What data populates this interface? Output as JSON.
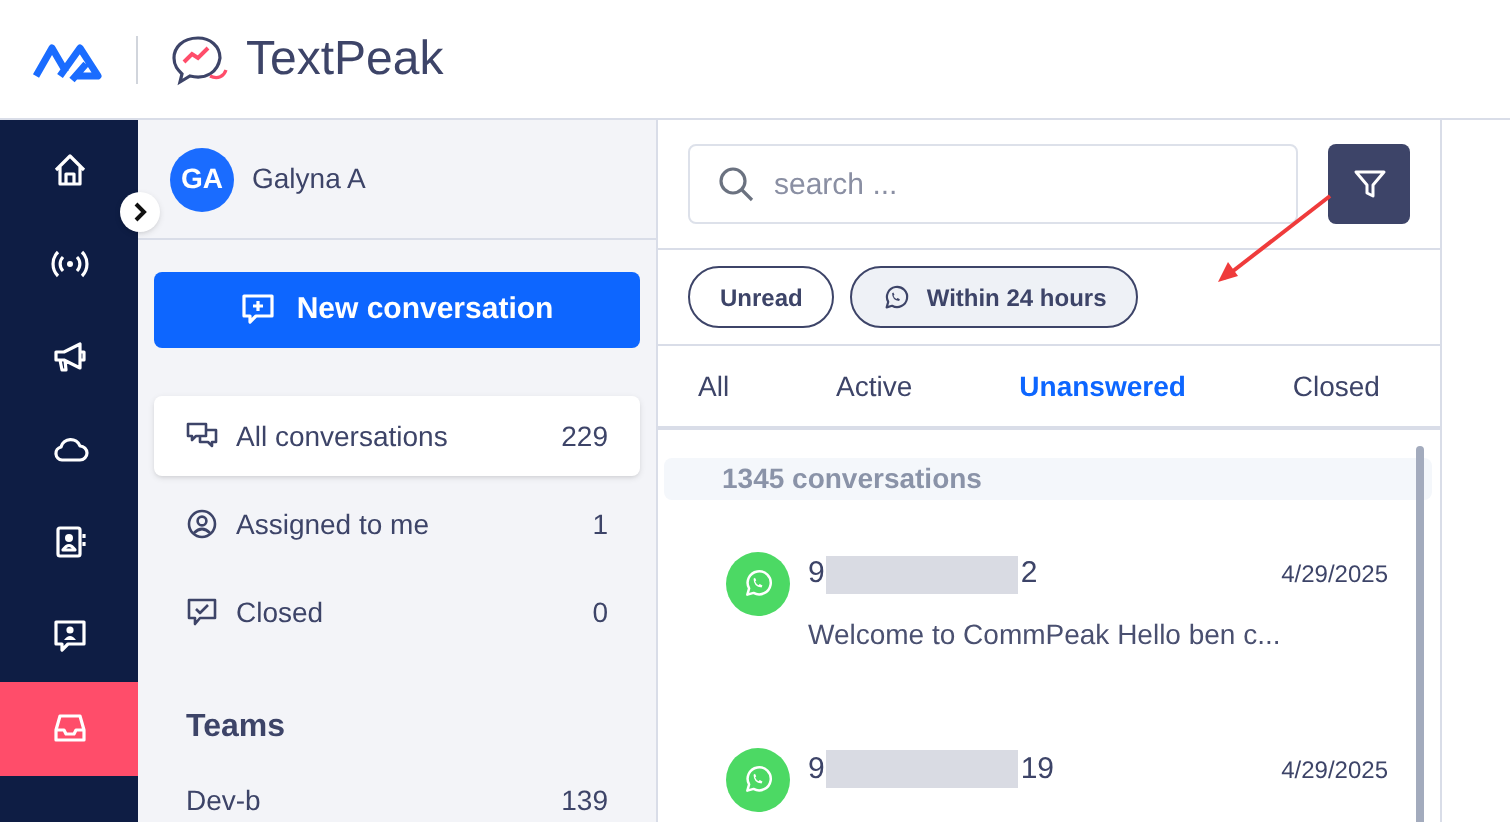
{
  "header": {
    "product_name": "TextPeak"
  },
  "rail": [
    {
      "kind": "home",
      "selected": false
    },
    {
      "kind": "broadcast",
      "selected": false
    },
    {
      "kind": "megaphone",
      "selected": false
    },
    {
      "kind": "cloud",
      "selected": false
    },
    {
      "kind": "contacts",
      "selected": false
    },
    {
      "kind": "chat-user",
      "selected": false
    },
    {
      "kind": "inbox",
      "selected": true
    }
  ],
  "user": {
    "initials": "GA",
    "name": "Galyna A"
  },
  "new_conversation_button": "New conversation",
  "nav": [
    {
      "kind": "chats",
      "label": "All conversations",
      "count": "229",
      "selected": true
    },
    {
      "kind": "user",
      "label": "Assigned to me",
      "count": "1",
      "selected": false
    },
    {
      "kind": "check",
      "label": "Closed",
      "count": "0",
      "selected": false
    }
  ],
  "teams": {
    "title": "Teams",
    "items": [
      {
        "label": "Dev-b",
        "count": "139"
      }
    ]
  },
  "search": {
    "placeholder": "search ..."
  },
  "filters": [
    {
      "label": "Unread",
      "whatsapp": false,
      "selected": false
    },
    {
      "label": "Within 24 hours",
      "whatsapp": true,
      "selected": true
    }
  ],
  "tabs": [
    {
      "label": "All",
      "selected": false
    },
    {
      "label": "Active",
      "selected": false
    },
    {
      "label": "Unanswered",
      "selected": true
    },
    {
      "label": "Closed",
      "selected": false
    }
  ],
  "conversation_count": "1345 conversations",
  "conversations": [
    {
      "name_start": "9",
      "name_end": "2",
      "date": "4/29/2025",
      "preview": "Welcome to CommPeak Hello ben c..."
    },
    {
      "name_start": "9",
      "name_end": "19",
      "date": "4/29/2025"
    }
  ]
}
